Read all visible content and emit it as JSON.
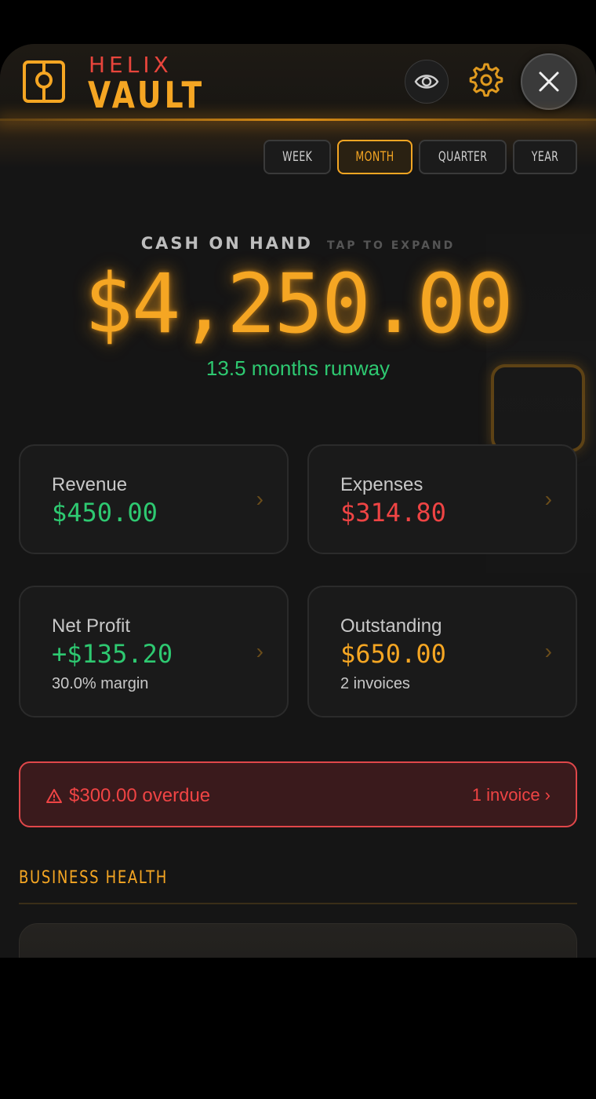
{
  "brand": {
    "top": "HELIX",
    "main": "VAULT"
  },
  "header": {
    "icons": [
      "safe-logo-icon",
      "eye-icon",
      "gear-icon",
      "close-icon"
    ],
    "accent": "#f5a623"
  },
  "periods": [
    {
      "label": "WEEK",
      "active": false
    },
    {
      "label": "MONTH",
      "active": true
    },
    {
      "label": "QUARTER",
      "active": false
    },
    {
      "label": "YEAR",
      "active": false
    }
  ],
  "cash": {
    "label": "CASH ON HAND",
    "hint": "TAP TO EXPAND",
    "amount": "$4,250.00",
    "runway": "13.5 months runway"
  },
  "cards": {
    "revenue": {
      "label": "Revenue",
      "value": "$450.00",
      "chevron": "›"
    },
    "expenses": {
      "label": "Expenses",
      "value": "$314.80",
      "chevron": "›"
    },
    "net_profit": {
      "label": "Net Profit",
      "value": "+$135.20",
      "sub": "30.0% margin",
      "chevron": "›"
    },
    "outstanding": {
      "label": "Outstanding",
      "value": "$650.00",
      "sub": "2 invoices",
      "chevron": "›"
    }
  },
  "alert": {
    "amount_text": "$300.00 overdue",
    "link": "1 invoice ›",
    "color": "#ef4444"
  },
  "section": {
    "title": "BUSINESS HEALTH"
  },
  "colors": {
    "positive": "#2ec971",
    "negative": "#ef4444",
    "warning": "#f5a623"
  }
}
